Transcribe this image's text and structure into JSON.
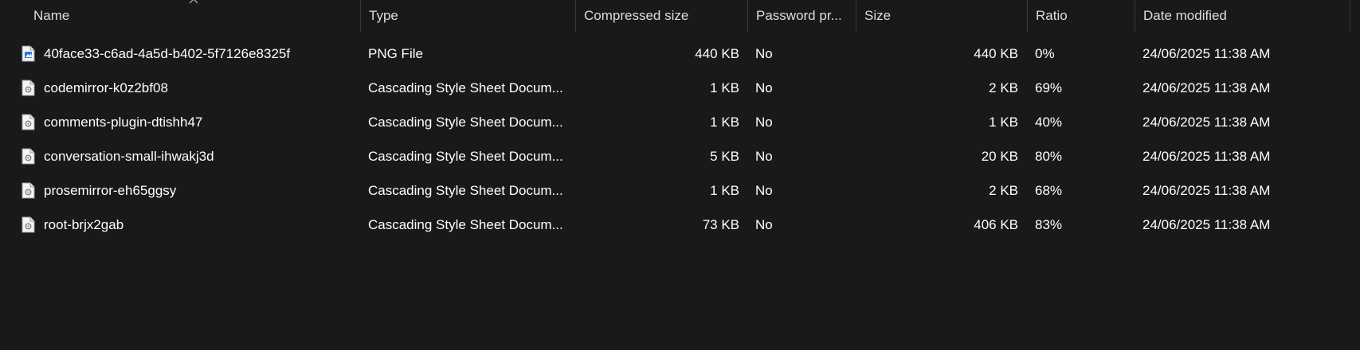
{
  "columns": {
    "name": "Name",
    "type": "Type",
    "compressed_size": "Compressed size",
    "password_protected": "Password pr...",
    "size": "Size",
    "ratio": "Ratio",
    "date_modified": "Date modified"
  },
  "files": [
    {
      "name": "40face33-c6ad-4a5d-b402-5f7126e8325f",
      "type": "PNG File",
      "compressed_size": "440 KB",
      "password_protected": "No",
      "size": "440 KB",
      "ratio": "0%",
      "date_modified": "24/06/2025 11:38 AM",
      "icon": "png-file-icon"
    },
    {
      "name": "codemirror-k0z2bf08",
      "type": "Cascading Style Sheet Docum...",
      "compressed_size": "1 KB",
      "password_protected": "No",
      "size": "2 KB",
      "ratio": "69%",
      "date_modified": "24/06/2025 11:38 AM",
      "icon": "css-file-icon"
    },
    {
      "name": "comments-plugin-dtishh47",
      "type": "Cascading Style Sheet Docum...",
      "compressed_size": "1 KB",
      "password_protected": "No",
      "size": "1 KB",
      "ratio": "40%",
      "date_modified": "24/06/2025 11:38 AM",
      "icon": "css-file-icon"
    },
    {
      "name": "conversation-small-ihwakj3d",
      "type": "Cascading Style Sheet Docum...",
      "compressed_size": "5 KB",
      "password_protected": "No",
      "size": "20 KB",
      "ratio": "80%",
      "date_modified": "24/06/2025 11:38 AM",
      "icon": "css-file-icon"
    },
    {
      "name": "prosemirror-eh65ggsy",
      "type": "Cascading Style Sheet Docum...",
      "compressed_size": "1 KB",
      "password_protected": "No",
      "size": "2 KB",
      "ratio": "68%",
      "date_modified": "24/06/2025 11:38 AM",
      "icon": "css-file-icon"
    },
    {
      "name": "root-brjx2gab",
      "type": "Cascading Style Sheet Docum...",
      "compressed_size": "73 KB",
      "password_protected": "No",
      "size": "406 KB",
      "ratio": "83%",
      "date_modified": "24/06/2025 11:38 AM",
      "icon": "css-file-icon"
    }
  ],
  "colors": {
    "background": "#191919",
    "text": "#ffffff",
    "header_text": "#dedede",
    "divider": "#3a3a3a",
    "png_icon_accent": "#2a78d6"
  }
}
